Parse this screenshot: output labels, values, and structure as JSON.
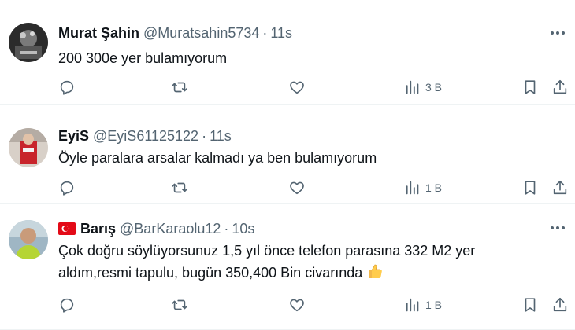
{
  "tweets": [
    {
      "name": "Murat Şahin",
      "handle": "@Muratsahin5734",
      "separator": "·",
      "time": "11s",
      "text": "200 300e yer bulamıyorum",
      "emoji": "",
      "views": "3 B",
      "flag": ""
    },
    {
      "name": "EyiS",
      "handle": "@EyiS61125122",
      "separator": "·",
      "time": "11s",
      "text": "Öyle paralara arsalar kalmadı ya ben bulamıyorum",
      "emoji": "",
      "views": "1 B",
      "flag": ""
    },
    {
      "name": "Barış",
      "handle": "@BarKaraolu12",
      "separator": "·",
      "time": "10s",
      "text": "Çok doğru söylüyorsunuz 1,5 yıl önce telefon parasına 332 M2 yer aldım,resmi tapulu, bugün 350,400 Bin civarında",
      "emoji": "thumbs-up",
      "views": "1 B",
      "flag": "turkey-flag"
    }
  ],
  "icons": {
    "reply": "reply-icon",
    "retweet": "retweet-icon",
    "like": "heart-icon",
    "views": "views-icon",
    "bookmark": "bookmark-icon",
    "share": "share-icon",
    "more": "more-icon"
  },
  "colors": {
    "text": "#0f1419",
    "secondary": "#536471",
    "divider": "#eff3f4",
    "flag_red": "#e30a17"
  }
}
